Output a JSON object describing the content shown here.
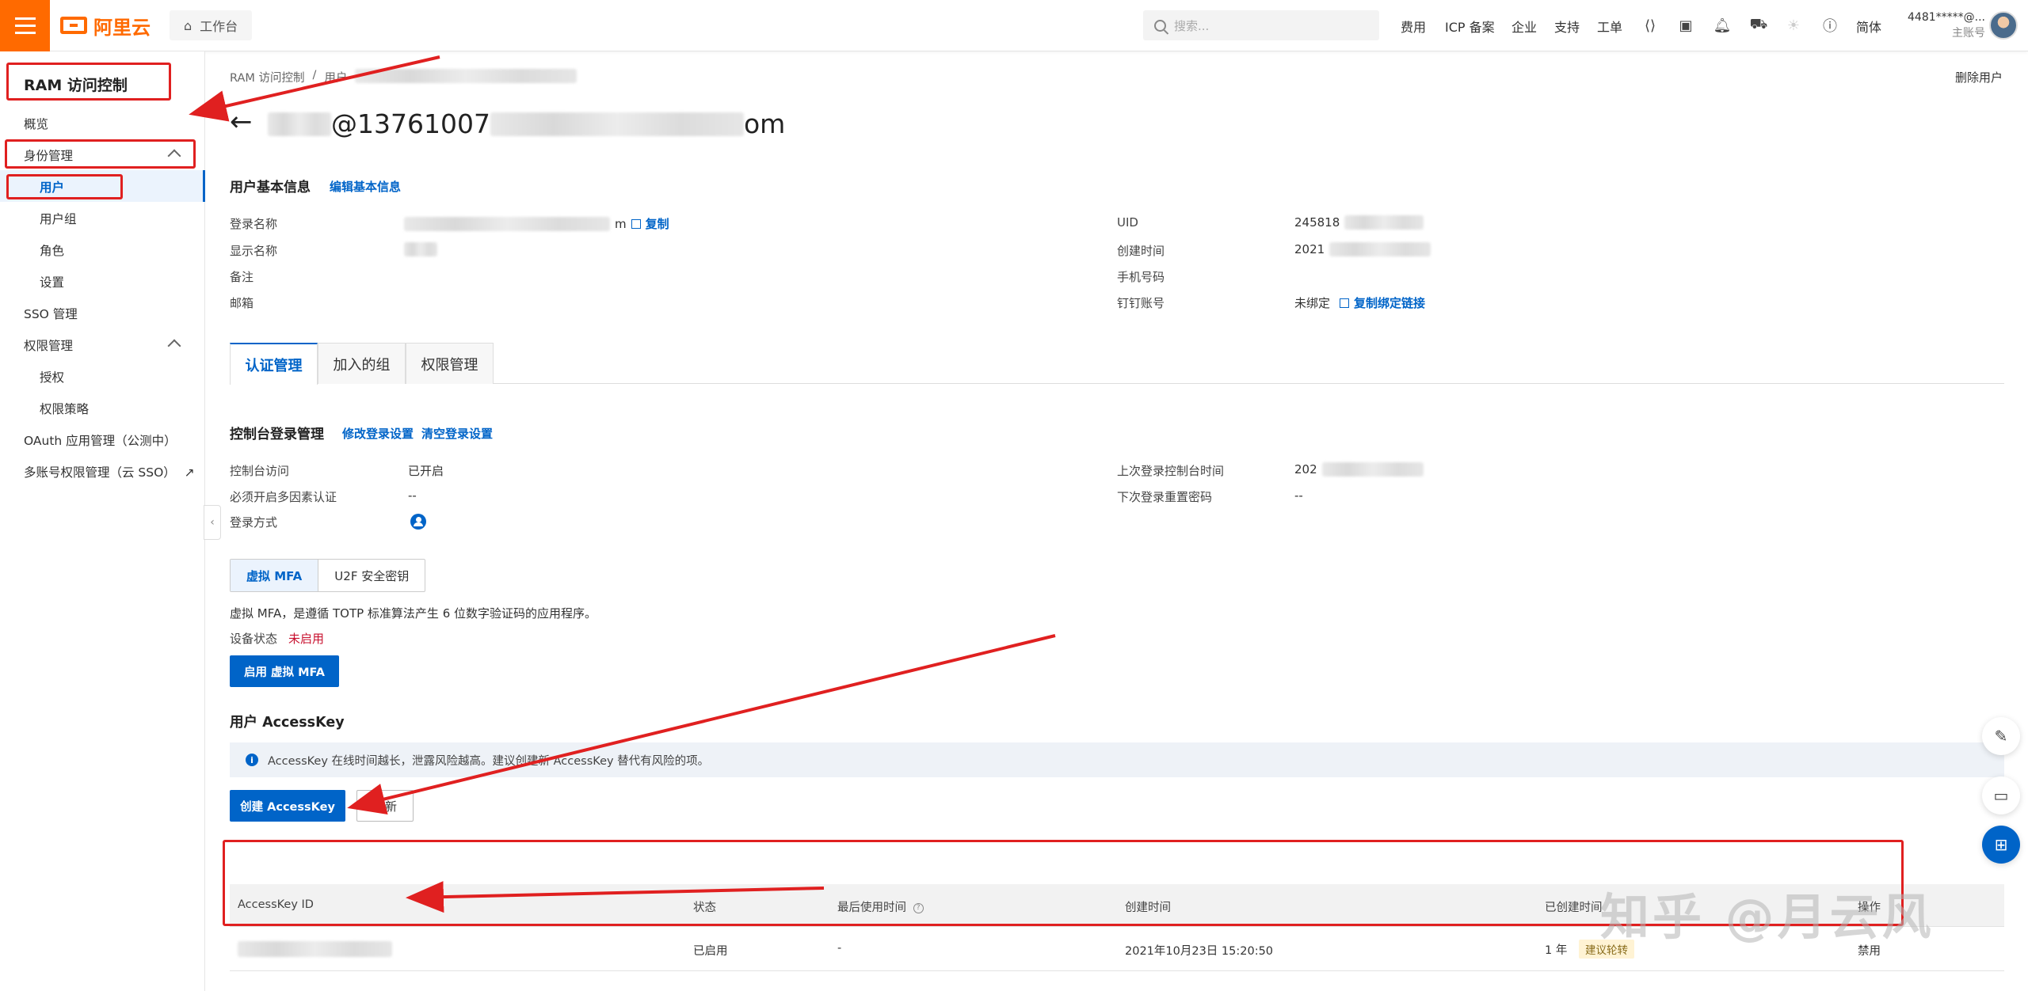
{
  "topbar": {
    "logo_text": "阿里云",
    "workbench_label": "工作台",
    "search_placeholder": "搜索...",
    "nav": [
      "费用",
      "ICP 备案",
      "企业",
      "支持",
      "工单"
    ],
    "lang": "简体",
    "account_id": "4481*****@...",
    "account_type": "主账号"
  },
  "sidebar": {
    "title": "RAM 访问控制",
    "overview": "概览",
    "identity": "身份管理",
    "users": "用户",
    "user_groups": "用户组",
    "roles": "角色",
    "settings": "设置",
    "sso": "SSO 管理",
    "permissions": "权限管理",
    "grant": "授权",
    "policies": "权限策略",
    "oauth": "OAuth 应用管理（公测中）",
    "multi_account": "多账号权限管理（云 SSO）"
  },
  "breadcrumb": [
    "RAM 访问控制",
    "用户"
  ],
  "delete_user": "删除用户",
  "page_title": {
    "visible_middle": "@13761007",
    "visible_end": "om"
  },
  "basic_info": {
    "title": "用户基本信息",
    "edit_link": "编辑基本信息",
    "login_name_label": "登录名称",
    "login_name_end": "m",
    "copy": "复制",
    "display_name_label": "显示名称",
    "remark_label": "备注",
    "email_label": "邮箱",
    "uid_label": "UID",
    "uid_value": "245818",
    "created_label": "创建时间",
    "created_value": "2021",
    "phone_label": "手机号码",
    "dingtalk_label": "钉钉账号",
    "dingtalk_value": "未绑定",
    "copy_bind_link": "复制绑定链接"
  },
  "tabs": [
    "认证管理",
    "加入的组",
    "权限管理"
  ],
  "console_login": {
    "title": "控制台登录管理",
    "modify": "修改登录设置",
    "clear": "清空登录设置",
    "access_label": "控制台访问",
    "access_value": "已开启",
    "mfa_required_label": "必须开启多因素认证",
    "mfa_required_value": "--",
    "login_method_label": "登录方式",
    "last_login_label": "上次登录控制台时间",
    "last_login_value": "202",
    "next_reset_label": "下次登录重置密码",
    "next_reset_value": "--"
  },
  "mfa": {
    "tabs": [
      "虚拟 MFA",
      "U2F 安全密钥"
    ],
    "description": "虚拟 MFA，是遵循 TOTP 标准算法产生 6 位数字验证码的应用程序。",
    "status_label": "设备状态",
    "status_value": "未启用",
    "enable_button": "启用 虚拟 MFA"
  },
  "accesskey": {
    "title": "用户 AccessKey",
    "notice": "AccessKey 在线时间越长，泄露风险越高。建议创建新 AccessKey 替代有风险的项。",
    "create_button": "创建 AccessKey",
    "refresh_button": "刷新",
    "columns": [
      "AccessKey ID",
      "状态",
      "最后使用时间",
      "创建时间",
      "已创建时间",
      "操作"
    ],
    "rows": [
      {
        "status": "已启用",
        "last_used": "-",
        "created": "2021年10月23日 15:20:50",
        "age": "1 年",
        "age_tag": "建议轮转",
        "action": "禁用"
      }
    ]
  },
  "watermark": "知乎 @月云风",
  "colors": {
    "brand": "#ff6a00",
    "primary": "#0064c8",
    "annotation": "#e02020"
  }
}
